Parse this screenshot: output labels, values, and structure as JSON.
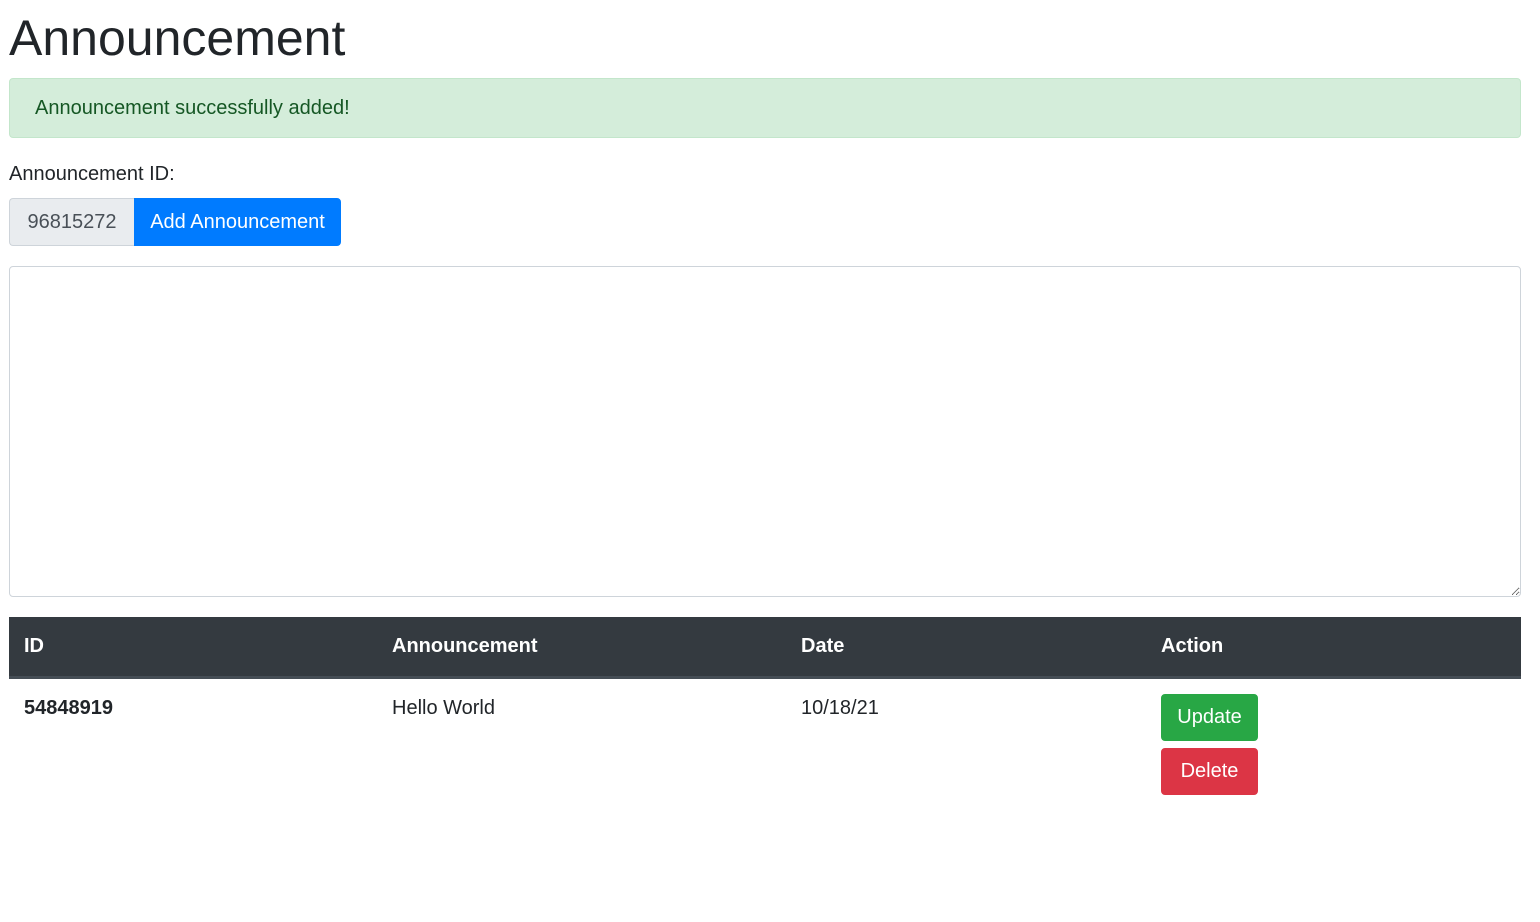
{
  "page": {
    "title": "Announcement"
  },
  "alert": {
    "message": "Announcement successfully added!"
  },
  "form": {
    "id_label": "Announcement ID:",
    "id_value": "96815272",
    "add_button_label": "Add Announcement",
    "textarea_value": ""
  },
  "table": {
    "headers": {
      "id": "ID",
      "announcement": "Announcement",
      "date": "Date",
      "action": "Action"
    },
    "rows": [
      {
        "id": "54848919",
        "announcement": "Hello World",
        "date": "10/18/21",
        "update_label": "Update",
        "delete_label": "Delete"
      }
    ]
  },
  "colors": {
    "primary": "#007bff",
    "success": "#28a745",
    "danger": "#dc3545",
    "alert_bg": "#d4edda",
    "alert_text": "#155724",
    "table_header_bg": "#343a40"
  }
}
